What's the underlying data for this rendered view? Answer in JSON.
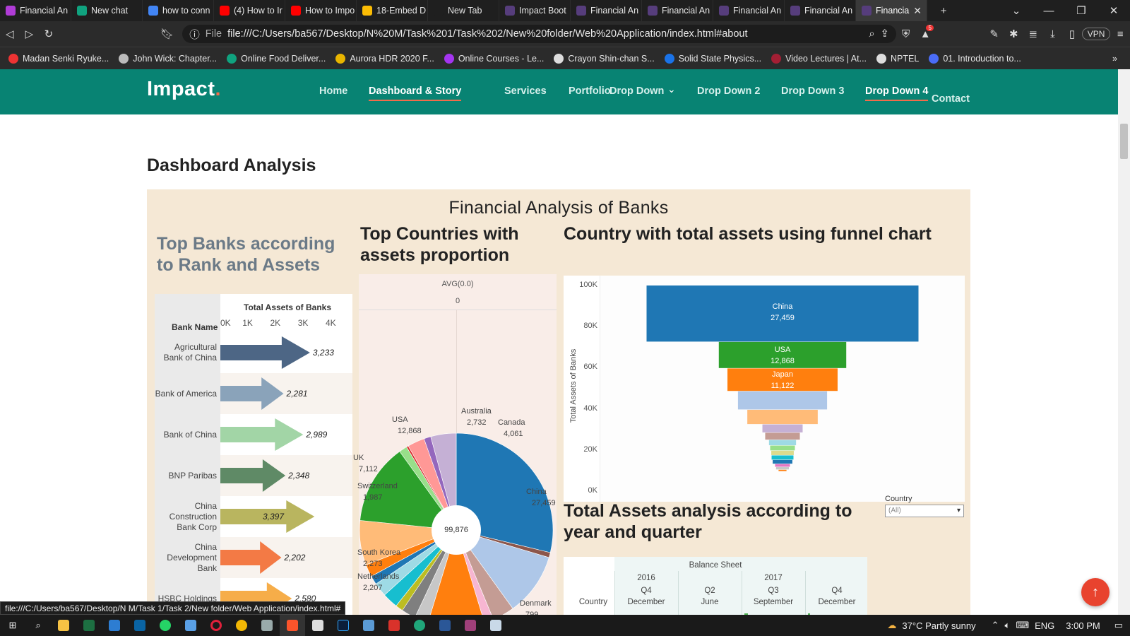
{
  "browser": {
    "tabs": [
      {
        "title": "Financial An",
        "fav": "#b03cd6",
        "active": false
      },
      {
        "title": "New chat",
        "fav": "#10a37f",
        "active": false
      },
      {
        "title": "how to conn",
        "fav": "#4285f4",
        "active": false
      },
      {
        "title": "(4) How to Ir",
        "fav": "#ff0000",
        "active": false
      },
      {
        "title": "How to Impo",
        "fav": "#ff0000",
        "active": false
      },
      {
        "title": "18-Embed D",
        "fav": "#fbbc04",
        "active": false
      },
      {
        "title": "New Tab",
        "fav": "#1f1f1f",
        "active": false
      },
      {
        "title": "Impact Boot",
        "fav": "#563d7c",
        "active": false
      },
      {
        "title": "Financial An",
        "fav": "#563d7c",
        "active": false
      },
      {
        "title": "Financial An",
        "fav": "#563d7c",
        "active": false
      },
      {
        "title": "Financial An",
        "fav": "#563d7c",
        "active": false
      },
      {
        "title": "Financial An",
        "fav": "#563d7c",
        "active": false
      },
      {
        "title": "Financia",
        "fav": "#563d7c",
        "active": true
      }
    ],
    "file_label": "File",
    "url": "file:///C:/Users/ba567/Desktop/N%20M/Task%201/Task%202/New%20folder/Web%20Application/index.html#about",
    "vpn_label": "VPN",
    "shield_badge": "5",
    "bookmarks": [
      {
        "label": "Madan Senki Ryuke...",
        "color": "#e33"
      },
      {
        "label": "John Wick: Chapter...",
        "color": "#bbb"
      },
      {
        "label": "Online Food Deliver...",
        "color": "#10a37f"
      },
      {
        "label": "Aurora HDR 2020 F...",
        "color": "#e8b500"
      },
      {
        "label": "Online Courses - Le...",
        "color": "#a435f0"
      },
      {
        "label": "Crayon Shin-chan S...",
        "color": "#ddd"
      },
      {
        "label": "Solid State Physics...",
        "color": "#1a73e8"
      },
      {
        "label": "Video Lectures | At...",
        "color": "#a31f34"
      },
      {
        "label": "NPTEL",
        "color": "#ddd"
      },
      {
        "label": "01. Introduction to...",
        "color": "#4a6cf7"
      }
    ]
  },
  "site": {
    "logo": "Impact",
    "logo_dot": ".",
    "nav": [
      {
        "label": "Home",
        "active": false
      },
      {
        "label": "Dashboard & Story",
        "active": true
      },
      {
        "label": "Services",
        "active": false
      },
      {
        "label": "Portfolio",
        "active": false
      },
      {
        "label": "Drop Down",
        "active": false
      },
      {
        "label": "Drop Down 2",
        "active": false
      },
      {
        "label": "Drop Down 3",
        "active": false
      },
      {
        "label": "Drop Down 4",
        "active": true
      },
      {
        "label": "Contact",
        "active": false
      }
    ],
    "section_title": "Dashboard Analysis",
    "viz_title": "Financial Analysis of Banks",
    "sheets": {
      "bars_title": "Top Banks according to Rank and Assets",
      "pie_title": "Top Countries with assets proportion",
      "funnel_title": "Country with total assets using funnel chart",
      "table_title": "Total Assets analysis according to year and quarter"
    },
    "filter": {
      "label": "Country",
      "value": "(All)"
    },
    "status_url": "file:///C:/Users/ba567/Desktop/N M/Task 1/Task 2/New folder/Web Application/index.html#"
  },
  "chart_data": [
    {
      "type": "bar",
      "title": "Total Assets of Banks",
      "xlabel": "Total Assets of Banks",
      "ylabel": "Bank Name",
      "xlim": [
        0,
        4000
      ],
      "xticks": [
        "0K",
        "1K",
        "2K",
        "3K",
        "4K"
      ],
      "categories": [
        "Agricultural Bank of China",
        "Bank of America",
        "Bank of China",
        "BNP Paribas",
        "China Construction Bank Corp",
        "China Development Bank",
        "HSBC Holdings"
      ],
      "values": [
        3233,
        2281,
        2989,
        2348,
        3397,
        2202,
        2580
      ],
      "value_labels": [
        "3,233",
        "2,281",
        "2,989",
        "2,348",
        "3,397",
        "2,202",
        "2,580"
      ],
      "colors": [
        "#4d6685",
        "#8aa3ba",
        "#a2d5a6",
        "#5f8a66",
        "#b9b55f",
        "#f37a45",
        "#f6ad49"
      ]
    },
    {
      "type": "pie",
      "header": "AVG(0.0)",
      "header_value": "0",
      "center_label": "99,876",
      "slices": [
        {
          "label": "China",
          "value": 27459,
          "value_label": "27,459",
          "color": "#1f77b4"
        },
        {
          "label": "Denmark",
          "value": 799,
          "value_label": "799",
          "color": "#8c564b"
        },
        {
          "label": "",
          "value": 10000,
          "value_label": "",
          "color": "#aec7e8"
        },
        {
          "label": "",
          "value": 3500,
          "value_label": "",
          "color": "#c49c94"
        },
        {
          "label": "",
          "value": 1500,
          "value_label": "",
          "color": "#f7b6d2"
        },
        {
          "label": "",
          "value": 9000,
          "value_label": "",
          "color": "#ff7f0e"
        },
        {
          "label": "Netherlands",
          "value": 2207,
          "value_label": "2,207",
          "color": "#c7c7c7"
        },
        {
          "label": "South Korea",
          "value": 2273,
          "value_label": "2,273",
          "color": "#7f7f7f"
        },
        {
          "label": "",
          "value": 1200,
          "value_label": "",
          "color": "#bcbd22"
        },
        {
          "label": "",
          "value": 2500,
          "value_label": "",
          "color": "#17becf"
        },
        {
          "label": "",
          "value": 2200,
          "value_label": "",
          "color": "#9edae5"
        },
        {
          "label": "",
          "value": 1400,
          "value_label": "",
          "color": "#1f77b4"
        },
        {
          "label": "Switzerland",
          "value": 1987,
          "value_label": "1,987",
          "color": "#ff7f0e"
        },
        {
          "label": "UK",
          "value": 7112,
          "value_label": "7,112",
          "color": "#ffbb78"
        },
        {
          "label": "USA",
          "value": 12868,
          "value_label": "12,868",
          "color": "#2ca02c"
        },
        {
          "label": "",
          "value": 1300,
          "value_label": "",
          "color": "#98df8a"
        },
        {
          "label": "",
          "value": 300,
          "value_label": "",
          "color": "#d62728"
        },
        {
          "label": "Australia",
          "value": 2732,
          "value_label": "2,732",
          "color": "#ff9896"
        },
        {
          "label": "",
          "value": 1100,
          "value_label": "",
          "color": "#9467bd"
        },
        {
          "label": "Canada",
          "value": 4061,
          "value_label": "4,061",
          "color": "#c5b0d5"
        }
      ]
    },
    {
      "type": "bar",
      "title": "Country with total assets using funnel chart",
      "ylabel": "Total Assets of Banks",
      "ylim": [
        0,
        100000
      ],
      "yticks": [
        "0K",
        "20K",
        "40K",
        "60K",
        "80K",
        "100K"
      ],
      "categories": [
        "China",
        "USA",
        "Japan",
        "",
        "",
        "",
        "",
        "",
        "",
        "",
        "",
        "",
        "",
        "",
        ""
      ],
      "values": [
        27459,
        12868,
        11122,
        9000,
        7112,
        4061,
        3500,
        2732,
        2500,
        2273,
        2207,
        1987,
        1500,
        1300,
        800
      ],
      "value_labels": [
        "27,459",
        "12,868",
        "11,122"
      ],
      "colors": [
        "#1f77b4",
        "#2ca02c",
        "#ff7f0e",
        "#aec7e8",
        "#ffbb78",
        "#c5b0d5",
        "#c49c94",
        "#9edae5",
        "#98df8a",
        "#dbdb8d",
        "#17becf",
        "#1f77b4",
        "#e377c2",
        "#c7c7c7",
        "#ff7f0e"
      ]
    },
    {
      "type": "table",
      "title": "Balance Sheet",
      "row_header": "Country",
      "years": [
        "2016",
        "2017"
      ],
      "quarters": [
        "Q4",
        "Q2",
        "Q3",
        "Q4"
      ],
      "months": [
        "December",
        "June",
        "September",
        "December"
      ]
    }
  ],
  "ui": {
    "taskbar_weather": "37°C  Partly sunny",
    "taskbar_lang": "ENG",
    "taskbar_time": "3:00 PM"
  }
}
